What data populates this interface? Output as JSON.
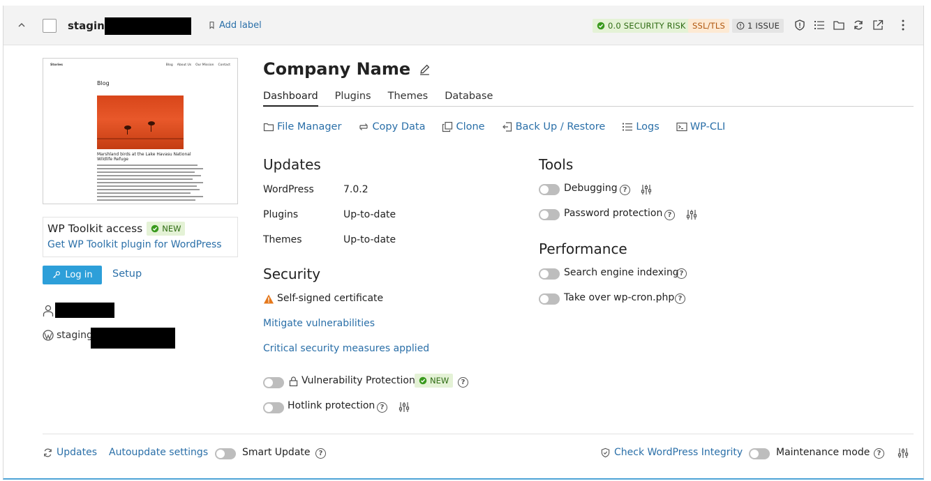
{
  "header": {
    "site_name": "staging.",
    "add_label": "Add label",
    "security_risk": "0.0 SECURITY RISK",
    "ssl": "SSL/TLS",
    "issues": "1 ISSUE"
  },
  "preview": {
    "nav_brand": "Stories",
    "nav_links": [
      "Blog",
      "About Us",
      "Our Mission",
      "Contact"
    ],
    "heading": "Blog",
    "caption": "Marshland birds at the Lake Havasu National Wildlife Refuge"
  },
  "toolkit": {
    "title": "WP Toolkit access",
    "new_badge": "NEW",
    "link": "Get WP Toolkit plugin for WordPress"
  },
  "login": {
    "button": "Log in",
    "setup": "Setup"
  },
  "domain_prefix": "staging.",
  "main": {
    "title": "Company Name",
    "tabs": [
      "Dashboard",
      "Plugins",
      "Themes",
      "Database"
    ],
    "actions": [
      "File Manager",
      "Copy Data",
      "Clone",
      "Back Up / Restore",
      "Logs",
      "WP-CLI"
    ]
  },
  "updates": {
    "title": "Updates",
    "rows": [
      {
        "label": "WordPress",
        "value": "7.0.2"
      },
      {
        "label": "Plugins",
        "value": "Up-to-date"
      },
      {
        "label": "Themes",
        "value": "Up-to-date"
      }
    ]
  },
  "security": {
    "title": "Security",
    "warning": "Self-signed certificate",
    "mitigate": "Mitigate vulnerabilities",
    "critical": "Critical security measures applied",
    "vuln_protection": "Vulnerability Protection",
    "vuln_new": "NEW",
    "hotlink": "Hotlink protection"
  },
  "tools": {
    "title": "Tools",
    "debugging": "Debugging",
    "password": "Password protection"
  },
  "performance": {
    "title": "Performance",
    "indexing": "Search engine indexing",
    "cron": "Take over wp-cron.php"
  },
  "footer": {
    "updates": "Updates",
    "autoupdate": "Autoupdate settings",
    "smart_update": "Smart Update",
    "integrity": "Check WordPress Integrity",
    "maintenance": "Maintenance mode"
  },
  "colors": {
    "link": "#2a6fa8",
    "primary_button": "#2d9fd9",
    "badge_green": "#e4f2d6",
    "badge_orange": "#fde9d3"
  }
}
